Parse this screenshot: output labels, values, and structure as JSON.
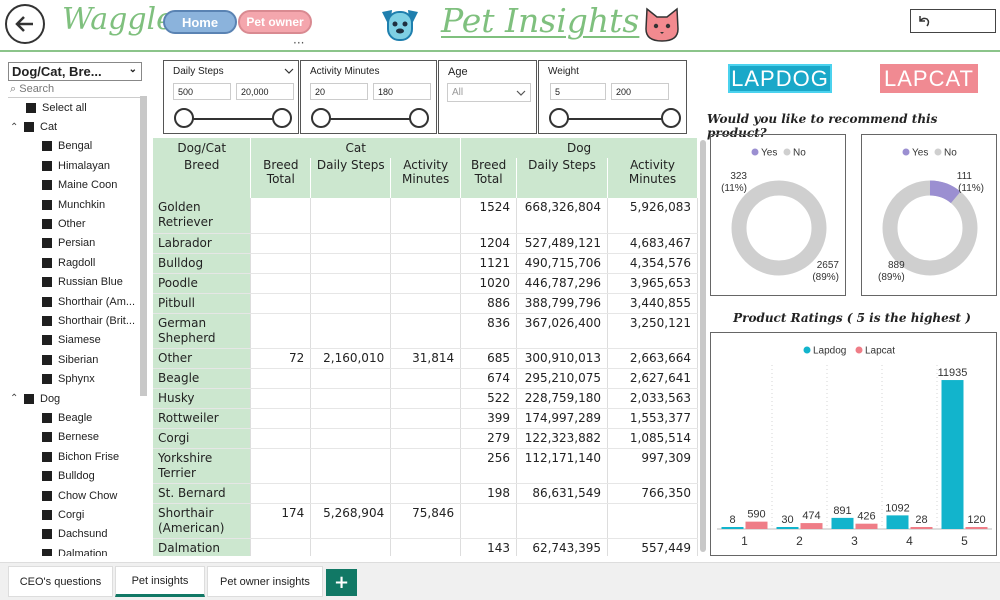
{
  "header": {
    "logo": "Waggle",
    "home_label": "Home",
    "pet_owner_label": "Pet owner",
    "more": "···",
    "title": "Pet Insights"
  },
  "slicer": {
    "dropdown_value": "Dog/Cat, Bre...",
    "search_placeholder": "Search",
    "items": [
      {
        "label": "Select all",
        "level": 0,
        "caret": ""
      },
      {
        "label": "Cat",
        "level": 0,
        "caret": "▵"
      },
      {
        "label": "Bengal",
        "level": 1
      },
      {
        "label": "Himalayan",
        "level": 1
      },
      {
        "label": "Maine Coon",
        "level": 1
      },
      {
        "label": "Munchkin",
        "level": 1
      },
      {
        "label": "Other",
        "level": 1
      },
      {
        "label": "Persian",
        "level": 1
      },
      {
        "label": "Ragdoll",
        "level": 1
      },
      {
        "label": "Russian Blue",
        "level": 1
      },
      {
        "label": "Shorthair (Am...",
        "level": 1
      },
      {
        "label": "Shorthair (Brit...",
        "level": 1
      },
      {
        "label": "Siamese",
        "level": 1
      },
      {
        "label": "Siberian",
        "level": 1
      },
      {
        "label": "Sphynx",
        "level": 1
      },
      {
        "label": "Dog",
        "level": 0,
        "caret": "▵"
      },
      {
        "label": "Beagle",
        "level": 1
      },
      {
        "label": "Bernese",
        "level": 1
      },
      {
        "label": "Bichon Frise",
        "level": 1
      },
      {
        "label": "Bulldog",
        "level": 1
      },
      {
        "label": "Chow Chow",
        "level": 1
      },
      {
        "label": "Corgi",
        "level": 1
      },
      {
        "label": "Dachsund",
        "level": 1
      },
      {
        "label": "Dalmation",
        "level": 1
      }
    ]
  },
  "filters": {
    "daily_steps": {
      "label": "Daily Steps",
      "min": "500",
      "max": "20,000"
    },
    "activity_minutes": {
      "label": "Activity Minutes",
      "min": "20",
      "max": "180"
    },
    "age": {
      "label": "Age",
      "value": "All"
    },
    "weight": {
      "label": "Weight",
      "min": "5",
      "max": "200"
    }
  },
  "table": {
    "corner": "Dog/Cat",
    "breed_header": "Breed",
    "group_cat": "Cat",
    "group_dog": "Dog",
    "cols": [
      "Breed Total",
      "Daily Steps",
      "Activity Minutes",
      "Breed Total",
      "Daily Steps",
      "Activity Minutes"
    ],
    "rows": [
      {
        "breed": "Golden Retriever",
        "vals": [
          "",
          "",
          "",
          "1524",
          "668,326,804",
          "5,926,083"
        ]
      },
      {
        "breed": "Labrador",
        "vals": [
          "",
          "",
          "",
          "1204",
          "527,489,121",
          "4,683,467"
        ]
      },
      {
        "breed": "Bulldog",
        "vals": [
          "",
          "",
          "",
          "1121",
          "490,715,706",
          "4,354,576"
        ]
      },
      {
        "breed": "Poodle",
        "vals": [
          "",
          "",
          "",
          "1020",
          "446,787,296",
          "3,965,653"
        ]
      },
      {
        "breed": "Pitbull",
        "vals": [
          "",
          "",
          "",
          "886",
          "388,799,796",
          "3,440,855"
        ]
      },
      {
        "breed": "German Shepherd",
        "vals": [
          "",
          "",
          "",
          "836",
          "367,026,400",
          "3,250,121"
        ]
      },
      {
        "breed": "Other",
        "vals": [
          "72",
          "2,160,010",
          "31,814",
          "685",
          "300,910,013",
          "2,663,664"
        ]
      },
      {
        "breed": "Beagle",
        "vals": [
          "",
          "",
          "",
          "674",
          "295,210,075",
          "2,627,641"
        ]
      },
      {
        "breed": "Husky",
        "vals": [
          "",
          "",
          "",
          "522",
          "228,759,180",
          "2,033,563"
        ]
      },
      {
        "breed": "Rottweiler",
        "vals": [
          "",
          "",
          "",
          "399",
          "174,997,289",
          "1,553,377"
        ]
      },
      {
        "breed": "Corgi",
        "vals": [
          "",
          "",
          "",
          "279",
          "122,323,882",
          "1,085,514"
        ]
      },
      {
        "breed": "Yorkshire Terrier",
        "vals": [
          "",
          "",
          "",
          "256",
          "112,171,140",
          "997,309"
        ]
      },
      {
        "breed": "St. Bernard",
        "vals": [
          "",
          "",
          "",
          "198",
          "86,631,549",
          "766,350"
        ]
      },
      {
        "breed": "Shorthair (American)",
        "vals": [
          "174",
          "5,268,904",
          "75,846",
          "",
          "",
          ""
        ]
      },
      {
        "breed": "Dalmation",
        "vals": [
          "",
          "",
          "",
          "143",
          "62,743,395",
          "557,449"
        ]
      }
    ]
  },
  "right": {
    "lapdog_brand": "LAPDOG",
    "lapcat_brand": "LAPCAT",
    "recommend_title": "Would you like to recommend this product?",
    "ratings_title": "Product Ratings ( 5 is the highest )",
    "yes_label": "Yes",
    "no_label": "No",
    "lapdog_series": "Lapdog",
    "lapcat_series": "Lapcat"
  },
  "colors": {
    "green_header": "#cce7cf",
    "yes": "#9b8fd1",
    "no": "#cfcfcf",
    "lapdog": "#12b4cc",
    "lapcat": "#ef7d87",
    "tab_accent": "#117865"
  },
  "chart_data": [
    {
      "type": "pie",
      "name": "lapdog-recommend",
      "labels": [
        "Yes",
        "No"
      ],
      "values": [
        2657,
        323
      ],
      "value_labels": [
        "2657",
        "323"
      ],
      "pct_labels": [
        "(89%)",
        "(11%)"
      ]
    },
    {
      "type": "pie",
      "name": "lapcat-recommend",
      "labels": [
        "Yes",
        "No"
      ],
      "values": [
        111,
        889
      ],
      "value_labels": [
        "111",
        "889"
      ],
      "pct_labels": [
        "(11%)",
        "(89%)"
      ]
    },
    {
      "type": "bar",
      "title": "Product Ratings ( 5 is the highest )",
      "categories": [
        "1",
        "2",
        "3",
        "4",
        "5"
      ],
      "series": [
        {
          "name": "Lapdog",
          "values": [
            8,
            30,
            891,
            1092,
            11935
          ]
        },
        {
          "name": "Lapcat",
          "values": [
            590,
            474,
            426,
            28,
            120
          ]
        }
      ],
      "ylim": [
        0,
        12500
      ]
    }
  ],
  "tabs": [
    "CEO's questions",
    "Pet insights",
    "Pet owner insights"
  ],
  "add_tab": "+"
}
